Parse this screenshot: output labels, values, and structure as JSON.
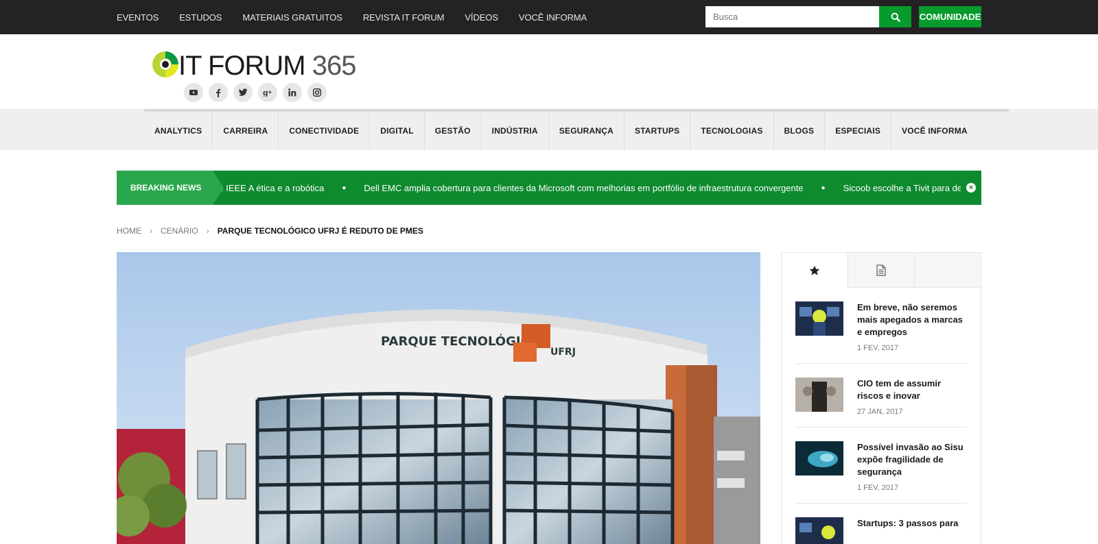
{
  "topnav": {
    "items": [
      "EVENTOS",
      "ESTUDOS",
      "MATERIAIS GRATUITOS",
      "REVISTA IT FORUM",
      "VÍDEOS",
      "VOCÊ INFORMA"
    ]
  },
  "search": {
    "placeholder": "Busca"
  },
  "community_button": "COMUNIDADE",
  "logo": {
    "text_main": "IT FORUM",
    "text_num": "365"
  },
  "socials": [
    "youtube-icon",
    "facebook-icon",
    "twitter-icon",
    "google-plus-icon",
    "linkedin-icon",
    "instagram-icon"
  ],
  "mainnav": {
    "items": [
      "ANALYTICS",
      "CARREIRA",
      "CONECTIVIDADE",
      "DIGITAL",
      "GESTÃO",
      "INDÚSTRIA",
      "SEGURANÇA",
      "STARTUPS",
      "TECNOLOGIAS",
      "BLOGS",
      "ESPECIAIS",
      "VOCÊ INFORMA"
    ]
  },
  "breaking": {
    "label": "BREAKING NEWS",
    "items": [
      ": IEEE A ética e a robótica",
      "Dell EMC amplia cobertura para clientes da Microsoft com melhorias em portfólio de infraestrutura convergente",
      "Sicoob escolhe a Tivit para desenvolver"
    ]
  },
  "breadcrumb": {
    "home": "HOME",
    "section": "CENÁRIO",
    "current": "PARQUE TECNOLÓGICO UFRJ É REDUTO DE PMES"
  },
  "hero": {
    "sign_text": "PARQUE TECNOLÓGICO",
    "sign_text2": "UFRJ"
  },
  "sidebar": {
    "tabs": [
      "star-icon",
      "document-icon"
    ],
    "posts": [
      {
        "title": "Em breve, não seremos mais apegados a marcas e empregos",
        "date": "1 FEV, 2017"
      },
      {
        "title": "CIO tem de assumir riscos e inovar",
        "date": "27 JAN, 2017"
      },
      {
        "title": "Possível invasão ao Sisu expõe fragilidade de segurança",
        "date": "1 FEV, 2017"
      },
      {
        "title": "Startups: 3 passos para",
        "date": ""
      }
    ]
  },
  "colors": {
    "topbar": "#242224",
    "accent_green": "#079a2d",
    "breaking_bg": "#0e8a2f",
    "breaking_label": "#2aa74c"
  }
}
